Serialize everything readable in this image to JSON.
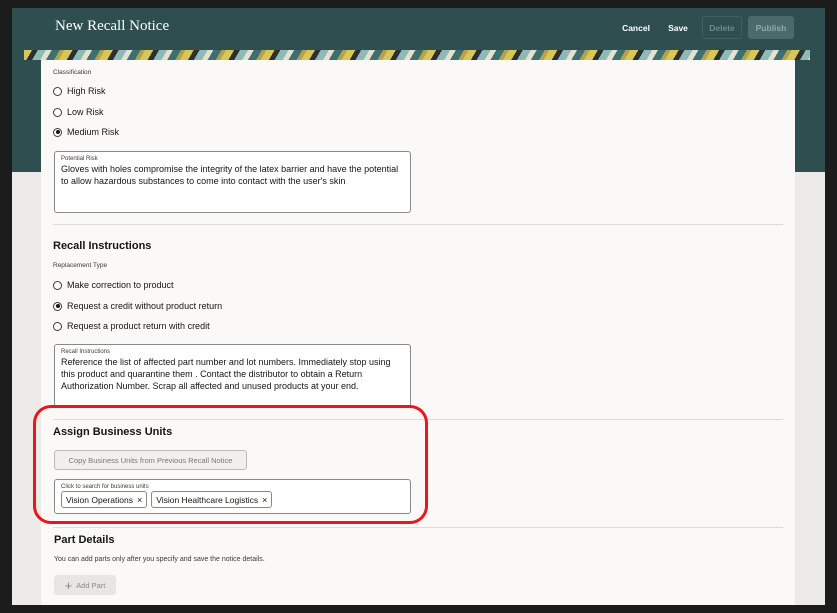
{
  "header": {
    "title": "New Recall Notice",
    "actions": {
      "cancel": "Cancel",
      "save": "Save",
      "delete": "Delete",
      "publish": "Publish"
    }
  },
  "classification": {
    "label": "Classification",
    "options": [
      "High Risk",
      "Low Risk",
      "Medium Risk"
    ],
    "selected": "Medium Risk"
  },
  "potential_risk": {
    "label": "Potential Risk",
    "value": "Gloves with holes compromise the integrity of the latex barrier and have the potential to allow hazardous substances to come into contact with the user's skin"
  },
  "recall_instructions": {
    "section_title": "Recall Instructions",
    "replacement_label": "Replacement Type",
    "options": [
      "Make correction to product",
      "Request a credit without product return",
      "Request a product return with credit"
    ],
    "selected": "Request a credit without product return",
    "instructions_label": "Recall Instructions",
    "instructions_value": "Reference the list of affected part number and lot numbers. Immediately stop using this product and quarantine them . Contact the distributor to obtain a Return Authorization Number. Scrap all affected and unused products at your end."
  },
  "business_units": {
    "section_title": "Assign Business Units",
    "copy_button": "Copy Business Units from Previous Recall Notice",
    "search_label": "Click to search for business units",
    "tags": [
      "Vision Operations",
      "Vision Healthcare Logistics"
    ]
  },
  "part_details": {
    "section_title": "Part Details",
    "hint": "You can add parts only after you specify and save the notice details.",
    "add_button": "Add Part"
  },
  "colors": {
    "header_bg": "#2e4e50",
    "highlight": "#e8161f"
  }
}
